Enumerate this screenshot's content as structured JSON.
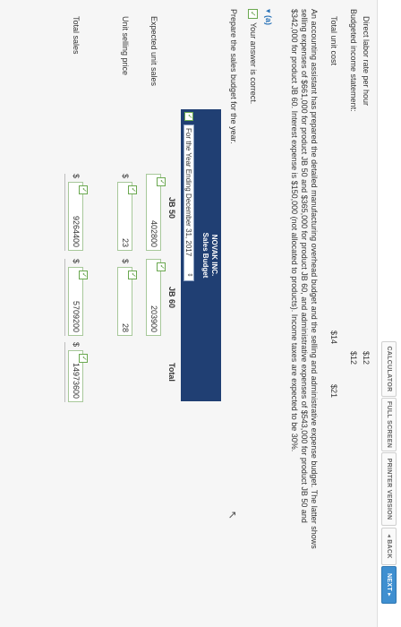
{
  "toolbar": {
    "calculator": "CALCULATOR",
    "full_screen": "FULL SCREEN",
    "printer_version": "PRINTER VERSION",
    "back": "◂ BACK",
    "next": "NEXT ▸"
  },
  "cost_table": {
    "direct_labor_label": "Direct labor rate per hour",
    "direct_labor_jb50": "$12",
    "direct_labor_jb60": "$12",
    "budgeted_income_label": "Budgeted income statement:",
    "total_unit_cost_label": "Total unit cost",
    "total_unit_cost_jb50": "$14",
    "total_unit_cost_jb60": "$21"
  },
  "description": "An accounting assistant has prepared the detailed manufacturing overhead budget and the selling and administrative expense budget. The latter shows selling expenses of $661,000 for product JB 50 and $365,000 for product JB 60, and administrative expenses of $543,000 for product JB 50 and $342,000 for product JB 60. Interest expense is $150,000 (not allocated to products). Income taxes are expected to be 30%.",
  "part": {
    "toggle": "▾ (a)",
    "status": "Your answer is correct.",
    "instruction": "Prepare the sales budget for the year."
  },
  "budget": {
    "company": "NOVAK INC.",
    "title": "Sales Budget",
    "period": "For the Year Ending December 31, 2017",
    "columns": [
      "JB 50",
      "JB 60",
      "Total"
    ],
    "rows": [
      {
        "label": "Expected unit sales",
        "jb50": "402800",
        "jb60": "203900",
        "total": ""
      },
      {
        "label": "Unit selling price",
        "jb50": "23",
        "jb60": "28",
        "total": ""
      },
      {
        "label": "Total sales",
        "jb50": "9264400",
        "jb60": "5709200",
        "total": "14973600"
      }
    ],
    "currency": "$"
  },
  "icons": {
    "check": "✓",
    "dropdown": "⇕"
  },
  "colors": {
    "header": "#203f73",
    "accent": "#3f8fd0",
    "correct": "#6aa84f"
  }
}
